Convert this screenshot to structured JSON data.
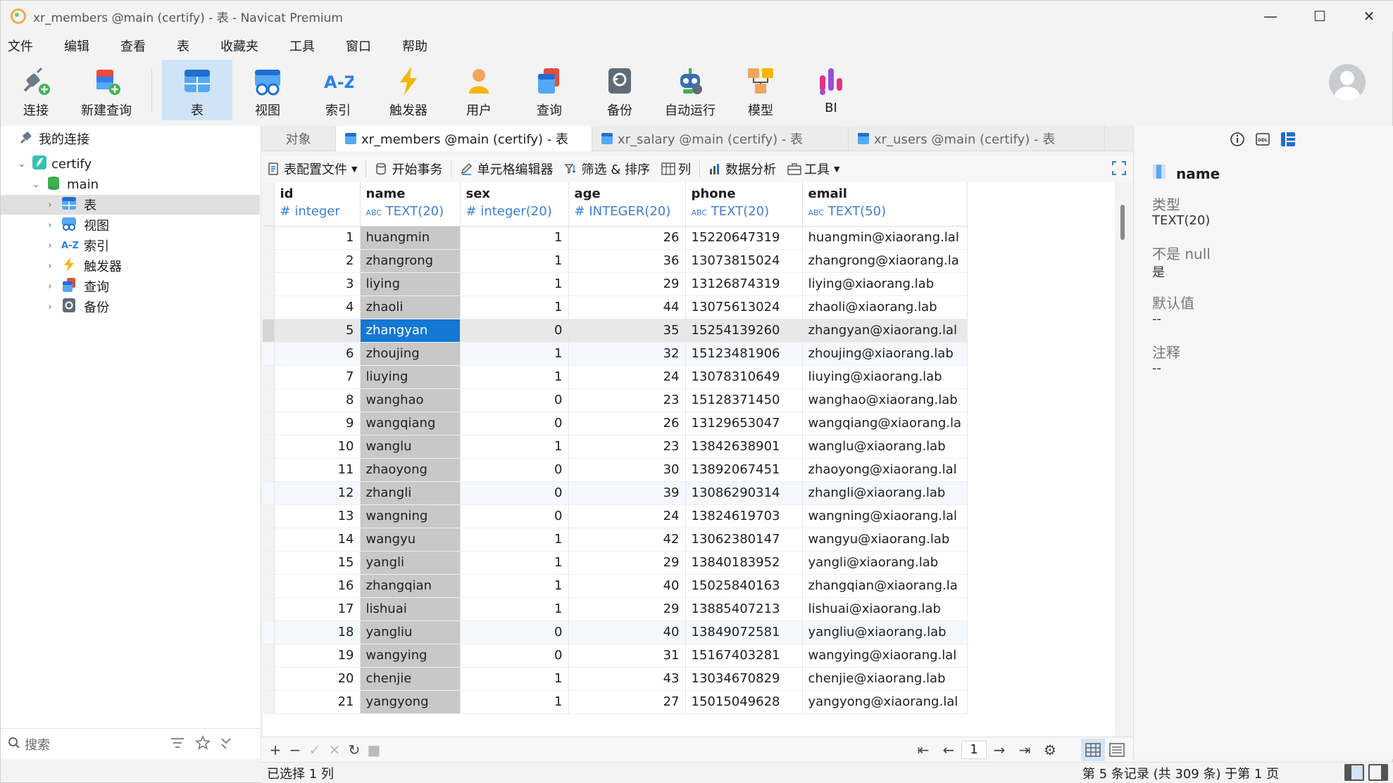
{
  "window": {
    "title": "xr_members @main (certify) - 表 - Navicat Premium",
    "min_label": "—",
    "max_label": "☐",
    "close_label": "✕"
  },
  "menu": [
    "文件",
    "编辑",
    "查看",
    "表",
    "收藏夹",
    "工具",
    "窗口",
    "帮助"
  ],
  "toolbar": {
    "items": [
      {
        "label": "连接",
        "icon": "connect-plug-icon"
      },
      {
        "label": "新建查询",
        "icon": "new-query-icon"
      },
      {
        "label": "表",
        "icon": "table-icon",
        "active": true
      },
      {
        "label": "视图",
        "icon": "view-icon"
      },
      {
        "label": "索引",
        "icon": "index-az-icon"
      },
      {
        "label": "触发器",
        "icon": "trigger-bolt-icon"
      },
      {
        "label": "用户",
        "icon": "user-icon"
      },
      {
        "label": "查询",
        "icon": "query-icon"
      },
      {
        "label": "备份",
        "icon": "backup-icon"
      },
      {
        "label": "自动运行",
        "icon": "robot-icon"
      },
      {
        "label": "模型",
        "icon": "model-icon"
      },
      {
        "label": "BI",
        "icon": "bi-chart-icon"
      }
    ]
  },
  "sidebar": {
    "root_label": "我的连接",
    "connection": "certify",
    "database": "main",
    "items": [
      {
        "label": "表",
        "icon": "table-icon",
        "selected": true
      },
      {
        "label": "视图",
        "icon": "view-icon"
      },
      {
        "label": "索引",
        "icon": "index-az-icon"
      },
      {
        "label": "触发器",
        "icon": "trigger-bolt-icon"
      },
      {
        "label": "查询",
        "icon": "query-icon"
      },
      {
        "label": "备份",
        "icon": "backup-icon"
      }
    ],
    "search_placeholder": "搜索"
  },
  "tabs": {
    "objects": "对象",
    "items": [
      {
        "label": "xr_members @main (certify) - 表",
        "active": true
      },
      {
        "label": "xr_salary @main (certify) - 表",
        "active": false
      },
      {
        "label": "xr_users @main (certify) - 表",
        "active": false
      }
    ]
  },
  "subtoolbar": {
    "table_config": "表配置文件",
    "begin_tx": "开始事务",
    "cell_editor": "单元格编辑器",
    "filter_sort": "筛选 & 排序",
    "columns": "列",
    "analysis": "数据分析",
    "tools": "工具"
  },
  "grid": {
    "columns": [
      {
        "name": "id",
        "type": "integer",
        "type_icon": "#"
      },
      {
        "name": "name",
        "type": "TEXT(20)",
        "type_icon": "ABC"
      },
      {
        "name": "sex",
        "type": "integer(20)",
        "type_icon": "#"
      },
      {
        "name": "age",
        "type": "INTEGER(20)",
        "type_icon": "#"
      },
      {
        "name": "phone",
        "type": "TEXT(20)",
        "type_icon": "ABC"
      },
      {
        "name": "email",
        "type": "TEXT(50)",
        "type_icon": "ABC"
      }
    ],
    "selected_row": 5,
    "rows": [
      [
        "1",
        "huangmin",
        "1",
        "26",
        "15220647319",
        "huangmin@xiaorang.lal"
      ],
      [
        "2",
        "zhangrong",
        "1",
        "36",
        "13073815024",
        "zhangrong@xiaorang.la"
      ],
      [
        "3",
        "liying",
        "1",
        "29",
        "13126874319",
        "liying@xiaorang.lab"
      ],
      [
        "4",
        "zhaoli",
        "1",
        "44",
        "13075613024",
        "zhaoli@xiaorang.lab"
      ],
      [
        "5",
        "zhangyan",
        "0",
        "35",
        "15254139260",
        "zhangyan@xiaorang.lal"
      ],
      [
        "6",
        "zhoujing",
        "1",
        "32",
        "15123481906",
        "zhoujing@xiaorang.lab"
      ],
      [
        "7",
        "liuying",
        "1",
        "24",
        "13078310649",
        "liuying@xiaorang.lab"
      ],
      [
        "8",
        "wanghao",
        "0",
        "23",
        "15128371450",
        "wanghao@xiaorang.lab"
      ],
      [
        "9",
        "wangqiang",
        "0",
        "26",
        "13129653047",
        "wangqiang@xiaorang.la"
      ],
      [
        "10",
        "wanglu",
        "1",
        "23",
        "13842638901",
        "wanglu@xiaorang.lab"
      ],
      [
        "11",
        "zhaoyong",
        "0",
        "30",
        "13892067451",
        "zhaoyong@xiaorang.lal"
      ],
      [
        "12",
        "zhangli",
        "0",
        "39",
        "13086290314",
        "zhangli@xiaorang.lab"
      ],
      [
        "13",
        "wangning",
        "0",
        "24",
        "13824619703",
        "wangning@xiaorang.lal"
      ],
      [
        "14",
        "wangyu",
        "1",
        "42",
        "13062380147",
        "wangyu@xiaorang.lab"
      ],
      [
        "15",
        "yangli",
        "1",
        "29",
        "13840183952",
        "yangli@xiaorang.lab"
      ],
      [
        "16",
        "zhangqian",
        "1",
        "40",
        "15025840163",
        "zhangqian@xiaorang.la"
      ],
      [
        "17",
        "lishuai",
        "1",
        "29",
        "13885407213",
        "lishuai@xiaorang.lab"
      ],
      [
        "18",
        "yangliu",
        "0",
        "40",
        "13849072581",
        "yangliu@xiaorang.lab"
      ],
      [
        "19",
        "wangying",
        "0",
        "31",
        "15167403281",
        "wangying@xiaorang.lal"
      ],
      [
        "20",
        "chenjie",
        "1",
        "43",
        "13034670829",
        "chenjie@xiaorang.lab"
      ],
      [
        "21",
        "yangyong",
        "1",
        "27",
        "15015049628",
        "yangyong@xiaorang.lal"
      ]
    ]
  },
  "bottombar": {
    "add": "+",
    "remove": "−",
    "apply": "✓",
    "discard": "✕",
    "refresh": "↻",
    "stop": "■",
    "first": "⇤",
    "prev": "←",
    "page": "1",
    "next": "→",
    "last": "⇥",
    "settings": "⚙"
  },
  "infopanel": {
    "field_name": "name",
    "type_label": "类型",
    "type_value": "TEXT(20)",
    "notnull_label": "不是 null",
    "notnull_value": "是",
    "default_label": "默认值",
    "default_value": "--",
    "comment_label": "注释",
    "comment_value": "--"
  },
  "status": {
    "left": "已选择 1 列",
    "right": "第 5 条记录 (共 309 条) 于第 1 页"
  },
  "colors": {
    "accent": "#1478d4",
    "active_tool_bg": "#cfe4f7",
    "type_blue": "#3d7fd6"
  }
}
